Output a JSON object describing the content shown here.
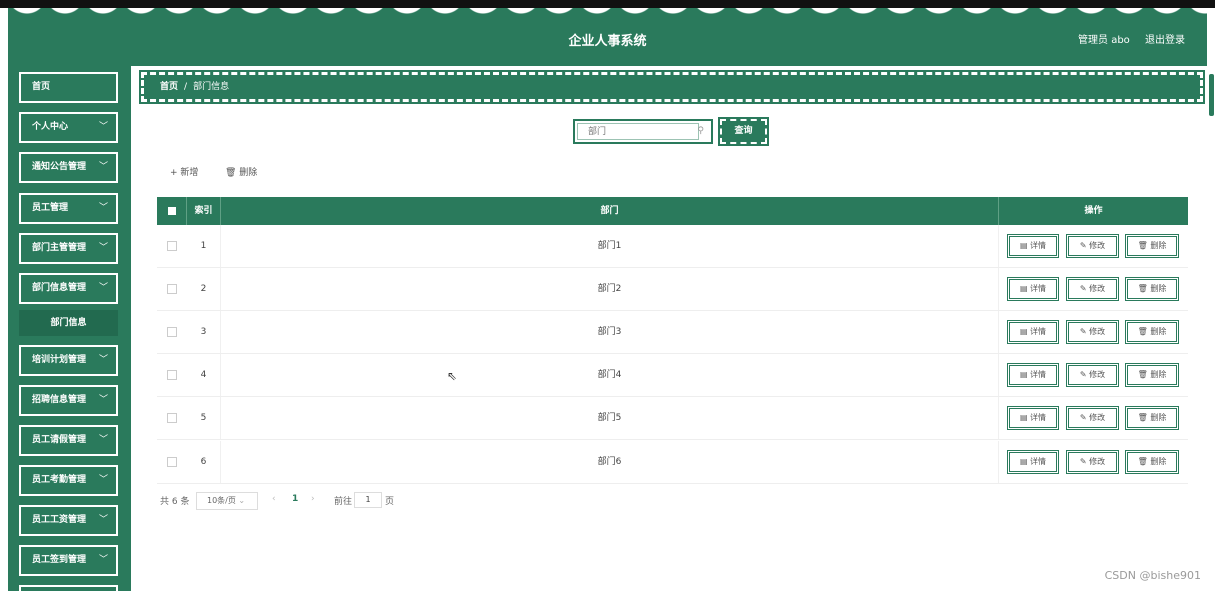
{
  "app": {
    "title": "企业人事系统",
    "user_label": "管理员 abo",
    "logout_label": "退出登录"
  },
  "colors": {
    "primary": "#2a7a5c",
    "dark": "#226a4f",
    "white": "#ffffff"
  },
  "sidebar": {
    "items": [
      {
        "label": "首页",
        "has_chevron": false
      },
      {
        "label": "个人中心",
        "has_chevron": true
      },
      {
        "label": "通知公告管理",
        "has_chevron": true
      },
      {
        "label": "员工管理",
        "has_chevron": true
      },
      {
        "label": "部门主管管理",
        "has_chevron": true
      },
      {
        "label": "部门信息管理",
        "has_chevron": true,
        "expanded": true
      },
      {
        "label": "培训计划管理",
        "has_chevron": true
      },
      {
        "label": "招聘信息管理",
        "has_chevron": true
      },
      {
        "label": "员工请假管理",
        "has_chevron": true
      },
      {
        "label": "员工考勤管理",
        "has_chevron": true
      },
      {
        "label": "员工工资管理",
        "has_chevron": true
      },
      {
        "label": "员工签到管理",
        "has_chevron": true
      }
    ],
    "submenu": {
      "label": "部门信息"
    },
    "chevron_glyph": "﹀"
  },
  "breadcrumb": {
    "home": "首页",
    "separator": "/",
    "current": "部门信息"
  },
  "search": {
    "placeholder": "部门",
    "button_label": "查询"
  },
  "toolbar": {
    "add_label": "+ 新增",
    "delete_label": "🗑 删除"
  },
  "table": {
    "headers": {
      "index": "索引",
      "department": "部门",
      "actions": "操作"
    },
    "rows": [
      {
        "index": "1",
        "department": "部门1"
      },
      {
        "index": "2",
        "department": "部门2"
      },
      {
        "index": "3",
        "department": "部门3"
      },
      {
        "index": "4",
        "department": "部门4"
      },
      {
        "index": "5",
        "department": "部门5"
      },
      {
        "index": "6",
        "department": "部门6"
      }
    ],
    "row_actions": {
      "detail": "▤ 详情",
      "edit": "✎ 修改",
      "delete": "🗑 删除"
    }
  },
  "pagination": {
    "total": "共 6 条",
    "page_size": "10条/页",
    "prev": "‹",
    "current_page": "1",
    "next": "›",
    "goto_label": "前往",
    "goto_value": "1",
    "page_suffix": "页"
  },
  "watermark": "CSDN @bishe901"
}
